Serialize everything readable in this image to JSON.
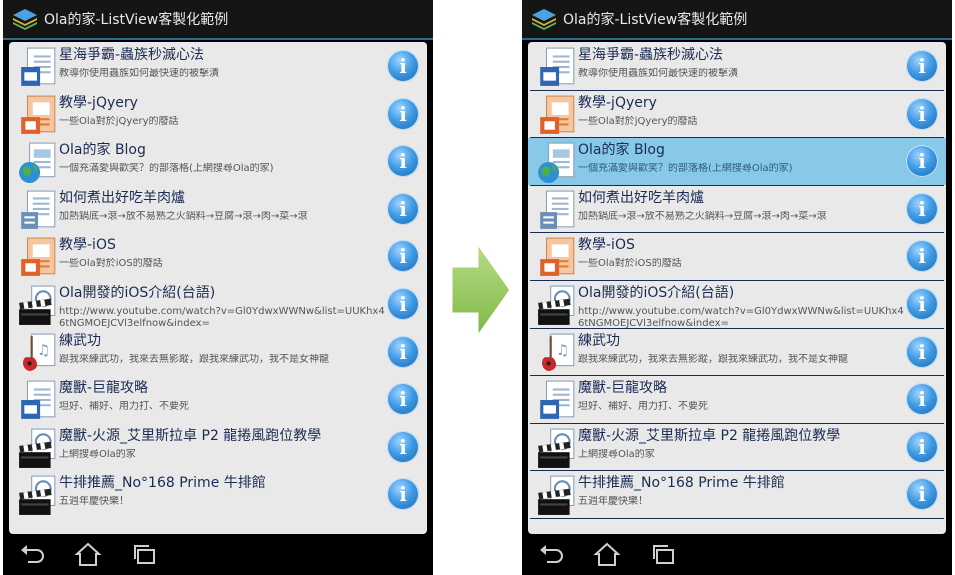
{
  "app": {
    "title": "Ola的家-ListView客製化範例"
  },
  "list_items": [
    {
      "title": "星海爭霸-蟲族秒滅心法",
      "subtitle": "教導你使用蟲族如何最快速的被擊潰",
      "icon": "word-document-icon"
    },
    {
      "title": "教學-jQyery",
      "subtitle": "一些Ola對於jQyery的廢話",
      "icon": "powerpoint-document-icon"
    },
    {
      "title": "Ola的家 Blog",
      "subtitle": "一個充滿愛與歡笑？的部落格(上網搜尋Ola的家)",
      "icon": "web-document-icon"
    },
    {
      "title": "如何煮出好吃羊肉爐",
      "subtitle": "加熱鍋底→滾→放不易熟之火鍋料→豆腐→滾→肉→菜→滾",
      "icon": "text-document-icon"
    },
    {
      "title": "教學-iOS",
      "subtitle": "一些Ola對於iOS的廢話",
      "icon": "powerpoint-document-icon"
    },
    {
      "title": "Ola開發的iOS介紹(台語)",
      "subtitle": "http://www.youtube.com/watch?v=Gl0YdwxWWNw&list=UUKhx46tNGMOEJCVl3elfnow&index=",
      "icon": "video-clapper-icon"
    },
    {
      "title": "練武功",
      "subtitle": "跟我來練武功，我來去無影蹤，跟我來練武功，我不是女神龍",
      "icon": "music-guitar-icon"
    },
    {
      "title": "魔獸-巨龍攻略",
      "subtitle": "坦好、補好、用力打、不要死",
      "icon": "word-document-icon"
    },
    {
      "title": "魔獸-火源_艾里斯拉卓 P2 龍捲風跑位教學",
      "subtitle": "上網搜尋Ola的家",
      "icon": "video-clapper-icon"
    },
    {
      "title": "牛排推薦_No°168 Prime 牛排館",
      "subtitle": "五週年慶快樂！",
      "icon": "video-clapper-icon"
    }
  ],
  "selected_index_right": 2,
  "colors": {
    "title_bar": "#151515",
    "accent_line": "#2c6d8f",
    "list_background": "#e9e9e9",
    "selected_row": "#88c9e7",
    "row_title": "#1b2c52",
    "info_button": "#3f9ae4",
    "arrow": "#93c957"
  },
  "icons": {
    "app": "layers-app-icon",
    "info": "info-icon",
    "nav_back": "back-icon",
    "nav_home": "home-icon",
    "nav_recents": "recent-apps-icon",
    "transition": "right-arrow-icon"
  },
  "info_button_glyph": "i"
}
